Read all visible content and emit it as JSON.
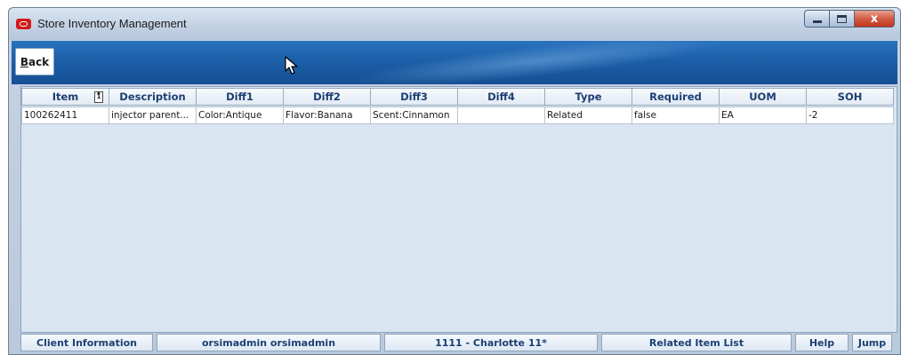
{
  "window": {
    "title": "Store Inventory Management",
    "controls": {
      "minimize": "minimize",
      "maximize": "maximize",
      "close": "x"
    }
  },
  "toolbar": {
    "back_label_accel": "B",
    "back_label_rest": "ack"
  },
  "table": {
    "columns": [
      "Item",
      "Description",
      "Diff1",
      "Diff2",
      "Diff3",
      "Diff4",
      "Type",
      "Required",
      "UOM",
      "SOH"
    ],
    "sort_indicator": "1",
    "rows": [
      [
        "100262411",
        "injector parent...",
        "Color:Antique",
        "Flavor:Banana",
        "Scent:Cinnamon",
        "",
        "Related",
        "false",
        "EA",
        "-2"
      ]
    ]
  },
  "statusbar": {
    "client_info": "Client Information",
    "user": "orsimadmin orsimadmin",
    "store": "1111 - Charlotte 11*",
    "screen": "Related Item List",
    "help": "Help",
    "jump": "Jump"
  },
  "colors": {
    "toolbar_blue": "#1b5fa8",
    "header_text": "#1c3f72",
    "grid_bg": "#d9e5f1"
  },
  "icons": {
    "app": "oracle-logo-icon",
    "cursor": "mouse-pointer-icon",
    "sort": "sort-ascending-icon"
  }
}
